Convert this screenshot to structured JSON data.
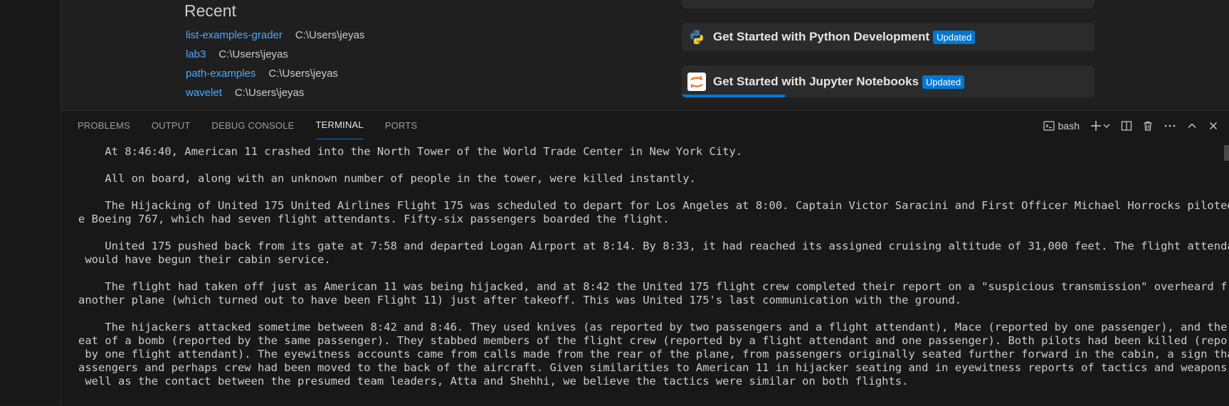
{
  "recent": {
    "heading": "Recent",
    "items": [
      {
        "name": "list-examples-grader",
        "path": "C:\\Users\\jeyas"
      },
      {
        "name": "lab3",
        "path": "C:\\Users\\jeyas"
      },
      {
        "name": "path-examples",
        "path": "C:\\Users\\jeyas"
      },
      {
        "name": "wavelet",
        "path": "C:\\Users\\jeyas"
      }
    ]
  },
  "walkthroughs": [
    {
      "title": "Get Started with Python Development",
      "badge": "Updated",
      "icon": "python-icon"
    },
    {
      "title": "Get Started with Jupyter Notebooks",
      "badge": "Updated",
      "icon": "jupyter-icon",
      "progress": 0.25
    }
  ],
  "panel": {
    "tabs": [
      "PROBLEMS",
      "OUTPUT",
      "DEBUG CONSOLE",
      "TERMINAL",
      "PORTS"
    ],
    "active_tab": "TERMINAL",
    "terminal_label": "bash",
    "icons": [
      "terminal-icon",
      "plus-icon",
      "chevron-down-icon",
      "split-icon",
      "trash-icon",
      "ellipsis-icon",
      "chevron-up-icon",
      "close-icon"
    ]
  },
  "terminal": {
    "lines": [
      "    At 8:46:40, American 11 crashed into the North Tower of the World Trade Center in New York City.",
      "",
      "    All on board, along with an unknown number of people in the tower, were killed instantly.",
      "",
      "    The Hijacking of United 175 United Airlines Flight 175 was scheduled to depart for Los Angeles at 8:00. Captain Victor Saracini and First Officer Michael Horrocks piloted th",
      "e Boeing 767, which had seven flight attendants. Fifty-six passengers boarded the flight.",
      "",
      "    United 175 pushed back from its gate at 7:58 and departed Logan Airport at 8:14. By 8:33, it had reached its assigned cruising altitude of 31,000 feet. The flight attendants",
      " would have begun their cabin service.",
      "",
      "    The flight had taken off just as American 11 was being hijacked, and at 8:42 the United 175 flight crew completed their report on a \"suspicious transmission\" overheard from",
      "another plane (which turned out to have been Flight 11) just after takeoff. This was United 175's last communication with the ground.",
      "",
      "    The hijackers attacked sometime between 8:42 and 8:46. They used knives (as reported by two passengers and a flight attendant), Mace (reported by one passenger), and the thr",
      "eat of a bomb (reported by the same passenger). They stabbed members of the flight crew (reported by a flight attendant and one passenger). Both pilots had been killed (reported",
      " by one flight attendant). The eyewitness accounts came from calls made from the rear of the plane, from passengers originally seated further forward in the cabin, a sign that p",
      "assengers and perhaps crew had been moved to the back of the aircraft. Given similarities to American 11 in hijacker seating and in eyewitness reports of tactics and weapons, as",
      " well as the contact between the presumed team leaders, Atta and Shehhi, we believe the tactics were similar on both flights."
    ]
  },
  "colors": {
    "accent": "#0078d4",
    "link": "#4daafc",
    "panel_bg": "#181818",
    "editor_bg": "#1f1f1f"
  }
}
